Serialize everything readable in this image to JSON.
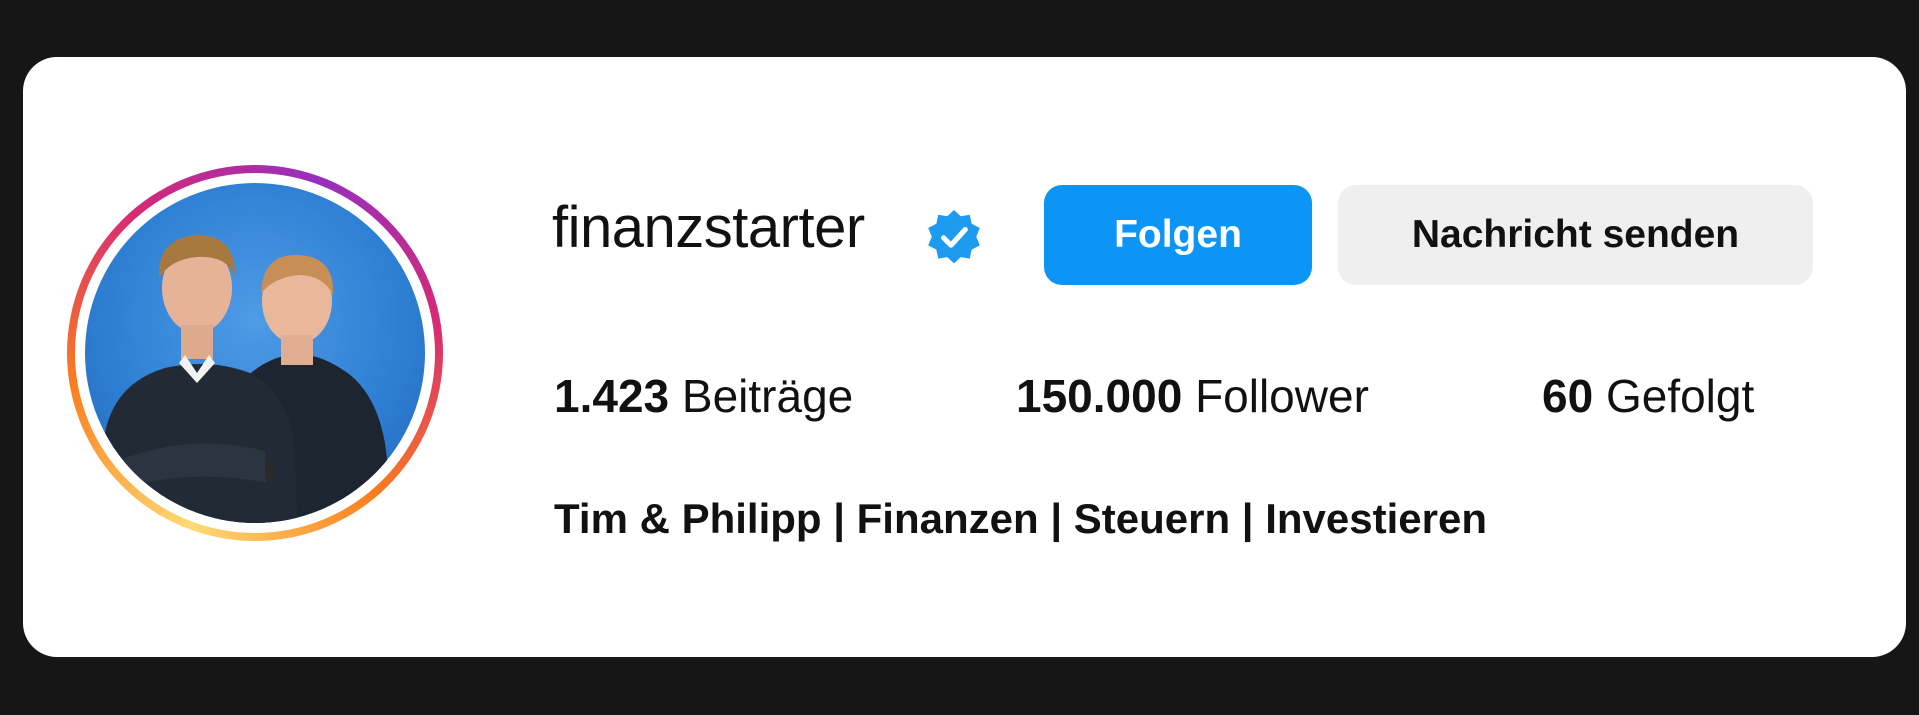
{
  "profile": {
    "username": "finanzstarter",
    "verified_icon": "verified-badge-icon",
    "avatar_icon": "profile-photo",
    "follow_label": "Folgen",
    "message_label": "Nachricht senden",
    "stats": {
      "posts_count": "1.423",
      "posts_label": "Beiträge",
      "followers_count": "150.000",
      "followers_label": "Follower",
      "following_count": "60",
      "following_label": "Gefolgt"
    },
    "bio": "Tim & Philipp | Finanzen | Steuern | Investieren"
  },
  "colors": {
    "follow_button": "#0d95f6",
    "message_button": "#efefef",
    "verified_badge": "#1d9bf0",
    "background": "#161616",
    "card": "#ffffff"
  }
}
